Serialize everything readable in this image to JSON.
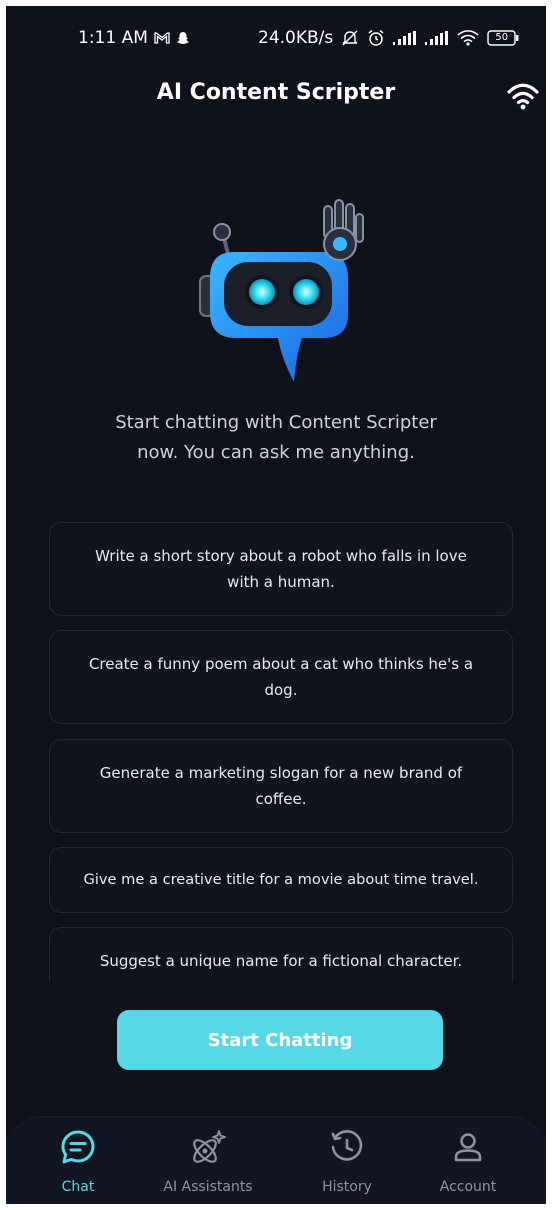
{
  "status_bar": {
    "time": "1:11 AM",
    "net_speed": "24.0KB/s",
    "battery": "50",
    "icons": [
      "gmail-icon",
      "snapchat-icon",
      "mute-icon",
      "alarm-icon",
      "signal-icon",
      "signal-icon",
      "wifi-icon",
      "battery-icon"
    ]
  },
  "app_bar": {
    "title": "AI Content Scripter",
    "action_icon": "wifi-icon"
  },
  "hero": {
    "mascot_icon": "robot-chat-icon",
    "line1": "Start chatting with Content Scripter",
    "line2": "now. You can ask me anything."
  },
  "suggestions": [
    {
      "line1": "Write a short story about a robot who falls in love",
      "line2": "with a human."
    },
    {
      "line1": "Create a funny poem about a cat who thinks he's a",
      "line2": "dog."
    },
    {
      "line1": "Generate a marketing slogan for a new brand of",
      "line2": "coffee."
    },
    {
      "line1": "Give me a creative title for a movie about time travel.",
      "line2": ""
    },
    {
      "line1": "Suggest a unique name for a fictional character.",
      "line2": ""
    }
  ],
  "cta": {
    "label": "Start Chatting"
  },
  "bottom_nav": {
    "active": "Chat",
    "accent_color": "#57d8e6",
    "items": [
      {
        "label": "Chat",
        "icon": "chat-icon"
      },
      {
        "label": "AI Assistants",
        "icon": "ai-assistants-icon"
      },
      {
        "label": "History",
        "icon": "history-icon"
      },
      {
        "label": "Account",
        "icon": "account-icon"
      }
    ]
  }
}
